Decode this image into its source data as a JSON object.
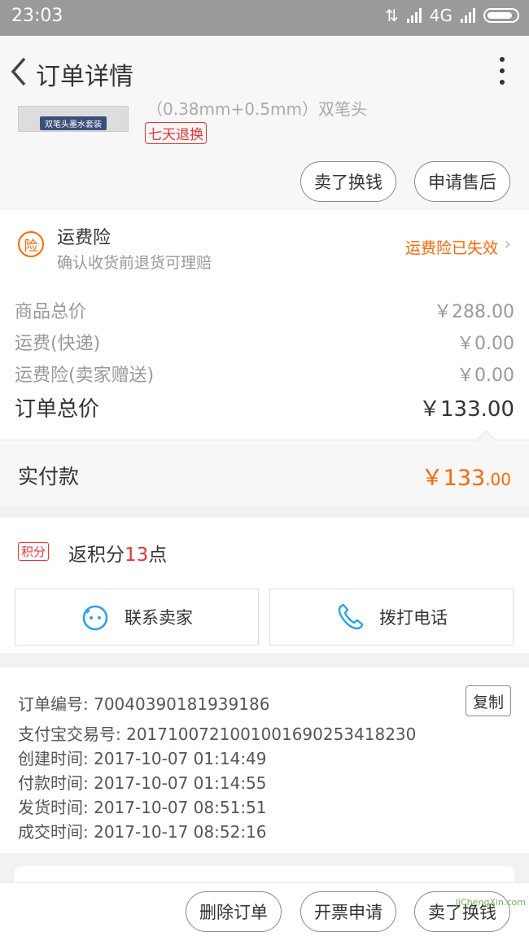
{
  "status_bar": {
    "time": "23:03",
    "network": "4G"
  },
  "header": {
    "title": "订单详情"
  },
  "product": {
    "thumb_label": "双笔头墨水套装",
    "spec": "（0.38mm+0.5mm）双笔头",
    "return_tag": "七天退换",
    "sell_button": "卖了换钱",
    "after_sale_button": "申请售后"
  },
  "insurance": {
    "icon_char": "险",
    "title": "运费险",
    "subtitle": "确认收货前退货可理赔",
    "status": "运费险已失效"
  },
  "prices": [
    {
      "label": "商品总价",
      "value": "￥288.00"
    },
    {
      "label": "运费(快递)",
      "value": "￥0.00"
    },
    {
      "label": "运费险(卖家赠送)",
      "value": "￥0.00"
    }
  ],
  "order_total": {
    "label": "订单总价",
    "value": "￥133.00"
  },
  "paid": {
    "label": "实付款",
    "value_main": "￥133",
    "value_decimal": ".00"
  },
  "points": {
    "badge": "积分",
    "text_prefix": "返积分",
    "count": "13",
    "text_suffix": "点"
  },
  "contact": {
    "seller": "联系卖家",
    "call": "拨打电话"
  },
  "order_info": {
    "copy_label": "复制",
    "lines": [
      "订单编号: 70040390181939186",
      "支付宝交易号: 2017100721001001690253418230",
      "创建时间: 2017-10-07 01:14:49",
      "付款时间: 2017-10-07 01:14:55",
      "发货时间: 2017-10-07 08:51:51",
      "成交时间: 2017-10-17 08:52:16"
    ]
  },
  "bottom_bar": {
    "delete": "删除订单",
    "invoice": "开票申请",
    "sell": "卖了换钱"
  },
  "watermark": "JiChengXin.com",
  "colors": {
    "accent": "#ff6600",
    "red": "#e33333",
    "status_bar": "#9a9a9a"
  }
}
